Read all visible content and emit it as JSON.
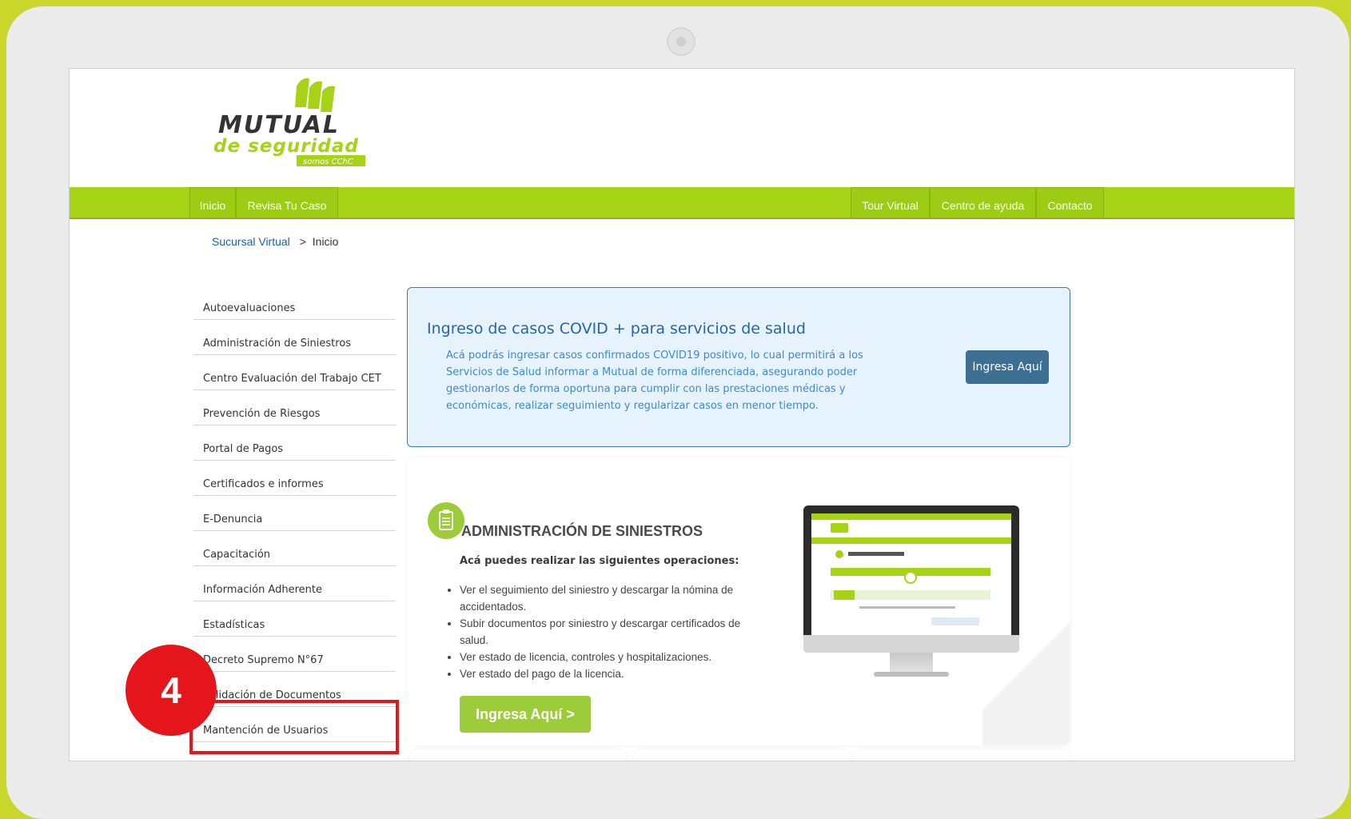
{
  "brand": {
    "line1": "MUTUAL",
    "line2": "de seguridad",
    "tagline": "somos CChC",
    "color": "#a6d316"
  },
  "nav": {
    "left": [
      {
        "label": "Inicio"
      },
      {
        "label": "Revisa Tu Caso"
      }
    ],
    "right": [
      {
        "label": "Tour Virtual"
      },
      {
        "label": "Centro de ayuda"
      },
      {
        "label": "Contacto"
      }
    ]
  },
  "breadcrumb": {
    "link": "Sucursal Virtual",
    "separator": ">",
    "current": "Inicio"
  },
  "sidebar": {
    "items": [
      {
        "label": "Autoevaluaciones"
      },
      {
        "label": "Administración de Siniestros"
      },
      {
        "label": "Centro Evaluación del Trabajo CET"
      },
      {
        "label": "Prevención de Riesgos"
      },
      {
        "label": "Portal de Pagos"
      },
      {
        "label": "Certificados e informes"
      },
      {
        "label": "E-Denuncia"
      },
      {
        "label": "Capacitación"
      },
      {
        "label": "Información Adherente"
      },
      {
        "label": "Estadísticas"
      },
      {
        "label": "Decreto Supremo N°67"
      },
      {
        "label": "Validación de Documentos"
      },
      {
        "label": "Mantención de Usuarios"
      }
    ]
  },
  "step_badge": {
    "number": "4",
    "color": "#e4161b"
  },
  "covid_box": {
    "title": "Ingreso de casos COVID + para servicios de salud",
    "text": "Acá podrás ingresar casos confirmados COVID19 positivo, lo cual permitirá a los Servicios de Salud informar a Mutual de forma diferenciada, asegurando poder gestionarlos de forma oportuna para cumplir con las prestaciones médicas y económicas, realizar seguimiento y regularizar casos en menor tiempo.",
    "button": "Ingresa Aquí"
  },
  "admin_card": {
    "title": "ADMINISTRACIÓN DE SINIESTROS",
    "subtitle": "Acá puedes realizar las siguientes operaciones:",
    "operations": [
      "Ver el seguimiento del siniestro y descargar la nómina de accidentados.",
      "Subir documentos por siniestro y descargar certificados de salud.",
      "Ver estado de licencia, controles y hospitalizaciones.",
      "Ver estado del pago de la licencia."
    ],
    "button": "Ingresa Aquí >",
    "icon": "clipboard-icon"
  }
}
